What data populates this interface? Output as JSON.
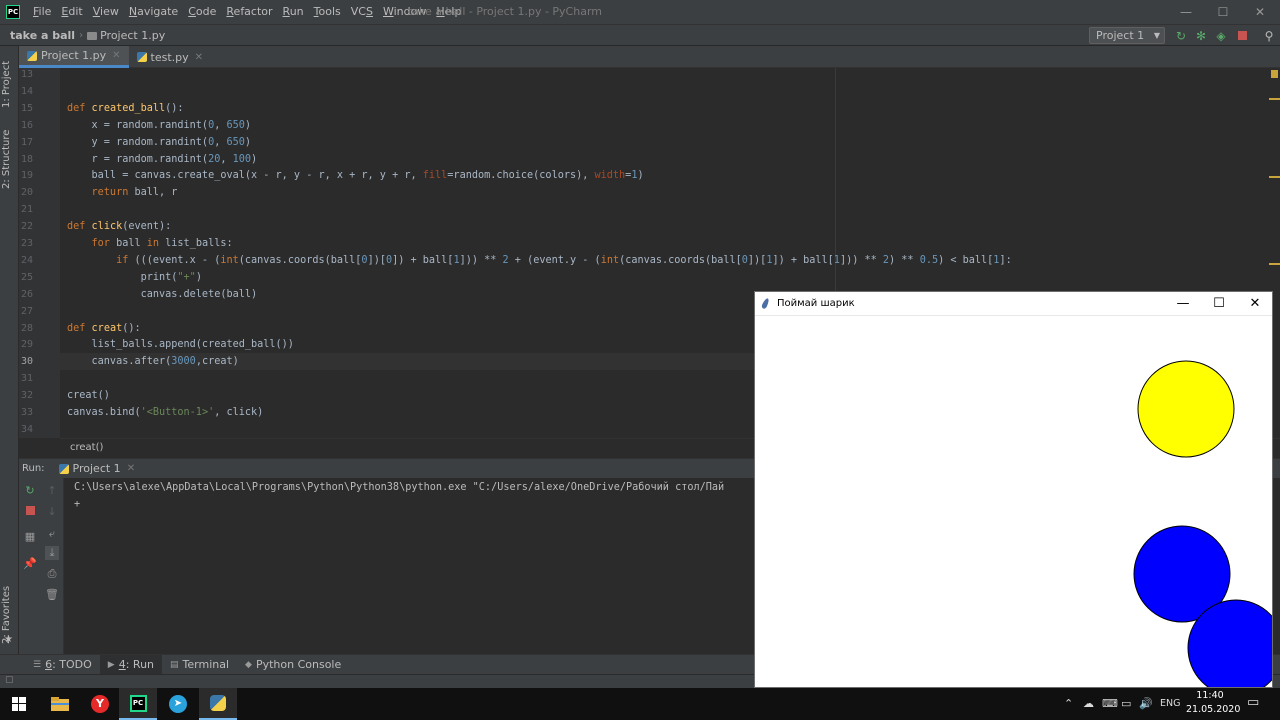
{
  "menu": {
    "items": [
      {
        "pre": "",
        "ul": "F",
        "post": "ile"
      },
      {
        "pre": "",
        "ul": "E",
        "post": "dit"
      },
      {
        "pre": "",
        "ul": "V",
        "post": "iew"
      },
      {
        "pre": "",
        "ul": "N",
        "post": "avigate"
      },
      {
        "pre": "",
        "ul": "C",
        "post": "ode"
      },
      {
        "pre": "",
        "ul": "R",
        "post": "efactor"
      },
      {
        "pre": "",
        "ul": "R",
        "post": "un"
      },
      {
        "pre": "",
        "ul": "T",
        "post": "ools"
      },
      {
        "pre": "VC",
        "ul": "S",
        "post": ""
      },
      {
        "pre": "",
        "ul": "W",
        "post": "indow"
      },
      {
        "pre": "",
        "ul": "H",
        "post": "elp"
      }
    ],
    "window_title": "take a ball - Project 1.py - PyCharm"
  },
  "window_controls": {
    "minimize": "—",
    "maximize": "☐",
    "close": "✕"
  },
  "navbar": {
    "project": "take a ball",
    "file": "Project 1.py",
    "run_config": "Project 1"
  },
  "left_strip": {
    "project_tab": "1: Project",
    "structure_tab": "2: Structure",
    "favorites_tab": "2: Favorites"
  },
  "editor_tabs": [
    {
      "label": "Project 1.py",
      "active": true
    },
    {
      "label": "test.py",
      "active": false
    }
  ],
  "line_numbers": [
    "13",
    "14",
    "15",
    "16",
    "17",
    "18",
    "19",
    "20",
    "21",
    "22",
    "23",
    "24",
    "25",
    "26",
    "27",
    "28",
    "29",
    "30",
    "31",
    "32",
    "33",
    "34"
  ],
  "code_lines": [
    [],
    [],
    [
      [
        "kw",
        "def "
      ],
      [
        "fn",
        "created_ball"
      ],
      [
        "",
        "():"
      ]
    ],
    [
      [
        "",
        "    x = random.randint("
      ],
      [
        "num",
        "0"
      ],
      [
        "",
        ", "
      ],
      [
        "num",
        "650"
      ],
      [
        "",
        ")"
      ]
    ],
    [
      [
        "",
        "    y = random.randint("
      ],
      [
        "num",
        "0"
      ],
      [
        "",
        ", "
      ],
      [
        "num",
        "650"
      ],
      [
        "",
        ")"
      ]
    ],
    [
      [
        "",
        "    r = random.randint("
      ],
      [
        "num",
        "20"
      ],
      [
        "",
        ", "
      ],
      [
        "num",
        "100"
      ],
      [
        "",
        ")"
      ]
    ],
    [
      [
        "",
        "    ball = canvas.create_oval(x - r, y - r, x + r, y + r, "
      ],
      [
        "prm",
        "fill"
      ],
      [
        "",
        "=random.choice(colors), "
      ],
      [
        "prm",
        "width"
      ],
      [
        "",
        "="
      ],
      [
        "num",
        "1"
      ],
      [
        "",
        ")"
      ]
    ],
    [
      [
        "kw",
        "    return "
      ],
      [
        "",
        "ball, r"
      ]
    ],
    [],
    [
      [
        "kw",
        "def "
      ],
      [
        "fn",
        "click"
      ],
      [
        "",
        "(event):"
      ]
    ],
    [
      [
        "kw",
        "    for "
      ],
      [
        "",
        "ball "
      ],
      [
        "kw",
        "in "
      ],
      [
        "",
        "list_balls:"
      ]
    ],
    [
      [
        "kw",
        "        if "
      ],
      [
        "",
        "(((event.x - ("
      ],
      [
        "kw",
        "int"
      ],
      [
        "",
        "(canvas.coords(ball["
      ],
      [
        "num",
        "0"
      ],
      [
        "",
        "])["
      ],
      [
        "num",
        "0"
      ],
      [
        "",
        "]) + ball["
      ],
      [
        "num",
        "1"
      ],
      [
        "",
        "])) ** "
      ],
      [
        "num",
        "2"
      ],
      [
        "",
        " + (event.y - ("
      ],
      [
        "kw",
        "int"
      ],
      [
        "",
        "(canvas.coords(ball["
      ],
      [
        "num",
        "0"
      ],
      [
        "",
        "])["
      ],
      [
        "num",
        "1"
      ],
      [
        "",
        "]) + ball["
      ],
      [
        "num",
        "1"
      ],
      [
        "",
        "])) ** "
      ],
      [
        "num",
        "2"
      ],
      [
        "",
        ") ** "
      ],
      [
        "num",
        "0.5"
      ],
      [
        "",
        ") < ball["
      ],
      [
        "num",
        "1"
      ],
      [
        "",
        "]:"
      ]
    ],
    [
      [
        "",
        "            print("
      ],
      [
        "str",
        "\"+\""
      ],
      [
        "",
        ")"
      ]
    ],
    [
      [
        "",
        "            canvas.delete(ball)"
      ]
    ],
    [],
    [
      [
        "kw",
        "def "
      ],
      [
        "fn",
        "creat"
      ],
      [
        "",
        "():"
      ]
    ],
    [
      [
        "",
        "    list_balls.append(created_ball())"
      ]
    ],
    [
      [
        "",
        "    canvas.after("
      ],
      [
        "num",
        "3000"
      ],
      [
        "",
        ",creat)"
      ]
    ],
    [],
    [
      [
        "",
        "creat()"
      ]
    ],
    [
      [
        "",
        "canvas.bind("
      ],
      [
        "str",
        "'<Button-1>'"
      ],
      [
        "",
        ", click)"
      ]
    ],
    []
  ],
  "breadcrumb_fn": "creat()",
  "run_panel": {
    "label": "Run:",
    "tab": "Project 1",
    "console": [
      "C:\\Users\\alexe\\AppData\\Local\\Programs\\Python\\Python38\\python.exe \"C:/Users/alexe/OneDrive/Рабочий стол/Пай",
      "+"
    ]
  },
  "bottom_tools": [
    {
      "num": "6",
      "label": ": TODO",
      "icon": "☰",
      "active": false
    },
    {
      "num": "4",
      "label": ": Run",
      "icon": "▶",
      "active": true
    },
    {
      "num": "",
      "label": "Terminal",
      "icon": "▤",
      "active": false
    },
    {
      "num": "",
      "label": "Python Console",
      "icon": "◆",
      "active": false
    }
  ],
  "tk_window": {
    "title": "Поймай шарик",
    "balls": [
      {
        "color": "#ffff00"
      },
      {
        "color": "#0000ff"
      },
      {
        "color": "#0000ff"
      }
    ]
  },
  "taskbar": {
    "time": "11:40",
    "date": "21.05.2020",
    "lang": "ENG"
  },
  "colors": {
    "keyword": "#cc7832",
    "function": "#ffc66d",
    "number": "#6897bb",
    "string": "#6a8759",
    "param": "#aa4926"
  }
}
